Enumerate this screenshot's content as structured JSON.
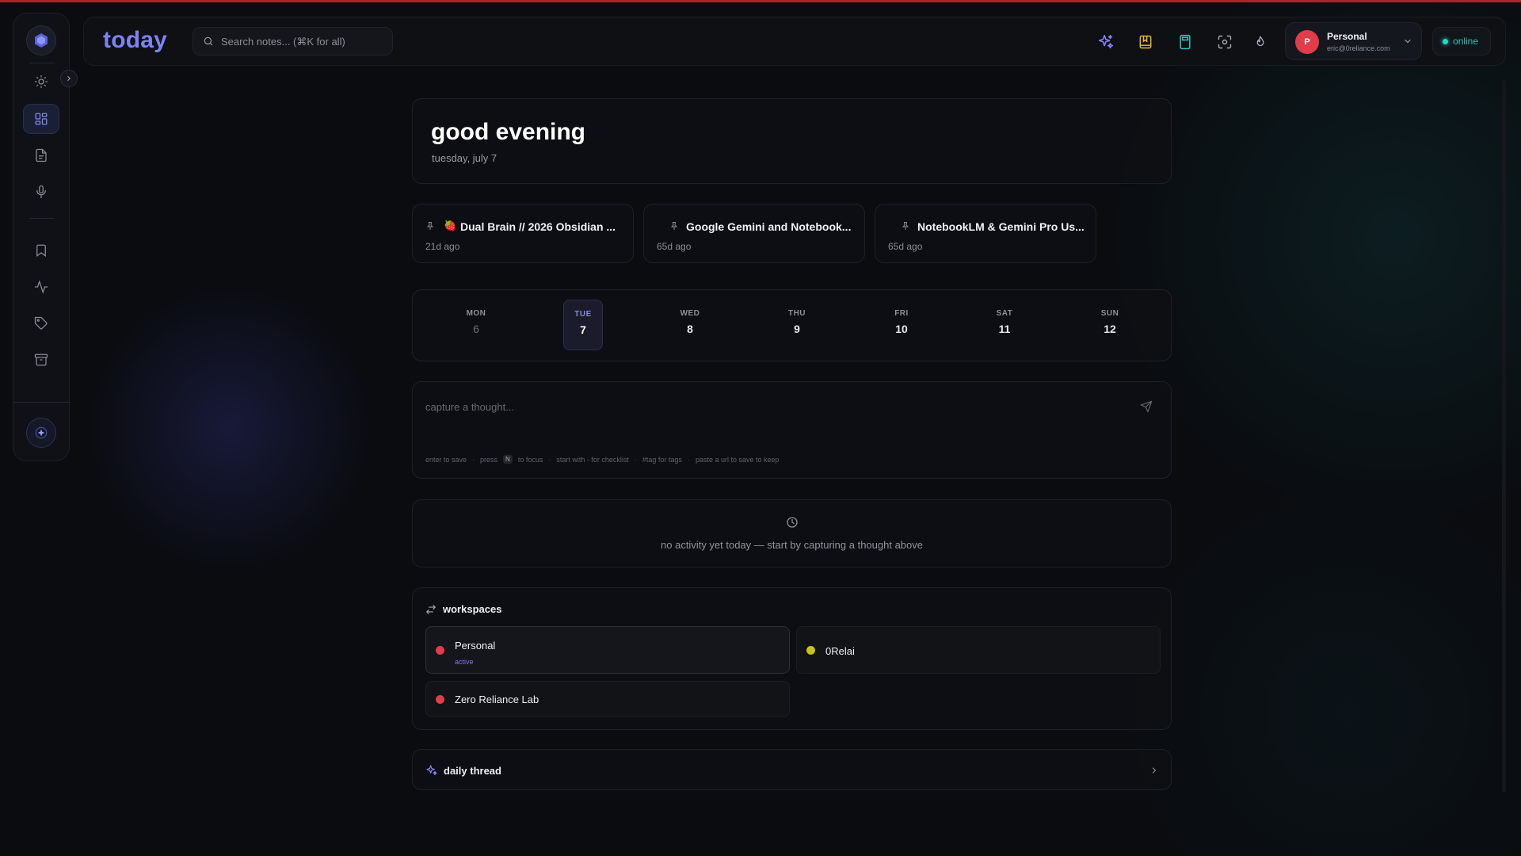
{
  "header": {
    "title": "today",
    "search_placeholder": "Search notes... (⌘K for all)"
  },
  "toolbar": {
    "icons": [
      "sparkles-icon",
      "bookmark-book-icon",
      "calculator-icon",
      "screenshot-icon",
      "fire-icon"
    ]
  },
  "profile": {
    "initial": "P",
    "name": "Personal",
    "email": "eric@0reliance.com"
  },
  "status": {
    "label": "online"
  },
  "greeting": {
    "title": "good evening",
    "date": "tuesday, july 7"
  },
  "pinned": [
    {
      "emoji": "🍓",
      "title": "Dual Brain // 2026 Obsidian ...",
      "time": "21d ago"
    },
    {
      "emoji": "",
      "title": "Google Gemini and Notebook...",
      "time": "65d ago"
    },
    {
      "emoji": "",
      "title": "NotebookLM & Gemini Pro Us...",
      "time": "65d ago"
    }
  ],
  "week": [
    {
      "name": "MON",
      "num": "6",
      "state": "past"
    },
    {
      "name": "TUE",
      "num": "7",
      "state": "active"
    },
    {
      "name": "WED",
      "num": "8",
      "state": "future"
    },
    {
      "name": "THU",
      "num": "9",
      "state": "future"
    },
    {
      "name": "FRI",
      "num": "10",
      "state": "future"
    },
    {
      "name": "SAT",
      "num": "11",
      "state": "future"
    },
    {
      "name": "SUN",
      "num": "12",
      "state": "future"
    }
  ],
  "capture": {
    "placeholder": "capture a thought...",
    "hints": {
      "enter": "enter to save",
      "press": "press",
      "key": "N",
      "focus": "to focus",
      "checklist": "start with - for checklist",
      "tags": "#tag for tags",
      "url": "paste a url to save to keep"
    }
  },
  "activity": {
    "empty_text": "no activity yet today — start by capturing a thought above"
  },
  "workspaces": {
    "title": "workspaces",
    "items": [
      {
        "name": "Personal",
        "sub": "active",
        "color": "#e23b4a"
      },
      {
        "name": "0Relai",
        "sub": "",
        "color": "#c9c21a"
      },
      {
        "name": "Zero Reliance Lab",
        "sub": "",
        "color": "#e23b4a"
      }
    ]
  },
  "thread": {
    "title": "daily thread"
  },
  "colors": {
    "accent": "#7d83f0",
    "online": "#2bd5c5",
    "danger": "#e23b4a"
  }
}
